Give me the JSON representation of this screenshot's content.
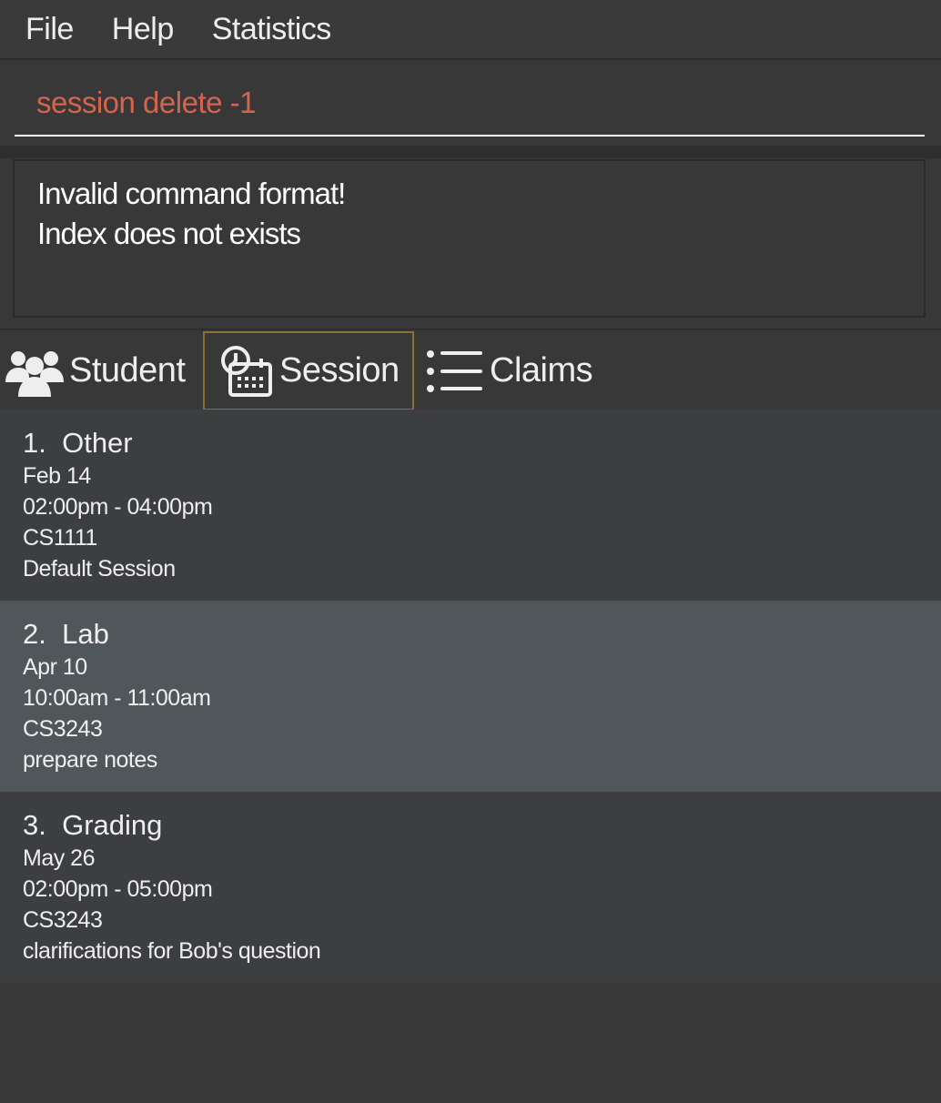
{
  "menu": [
    "File",
    "Help",
    "Statistics"
  ],
  "command": {
    "value": "session delete -1",
    "color": "#d4644f"
  },
  "result": {
    "lines": [
      "Invalid command format!",
      "Index does not exists"
    ]
  },
  "tabs": [
    {
      "label": "Student",
      "icon": "users-icon"
    },
    {
      "label": "Session",
      "icon": "calendar-clock-icon",
      "selected": true
    },
    {
      "label": "Claims",
      "icon": "list-icon"
    }
  ],
  "sessions": [
    {
      "index": "1.",
      "type": "Other",
      "date": "Feb 14",
      "time": "02:00pm - 04:00pm",
      "module": "CS1111",
      "remark": "Default Session"
    },
    {
      "index": "2.",
      "type": "Lab",
      "date": "Apr 10",
      "time": "10:00am - 11:00am",
      "module": "CS3243",
      "remark": "prepare notes",
      "selected": true
    },
    {
      "index": "3.",
      "type": "Grading",
      "date": "May 26",
      "time": "02:00pm - 05:00pm",
      "module": "CS3243",
      "remark": "clarifications for Bob's question"
    }
  ]
}
